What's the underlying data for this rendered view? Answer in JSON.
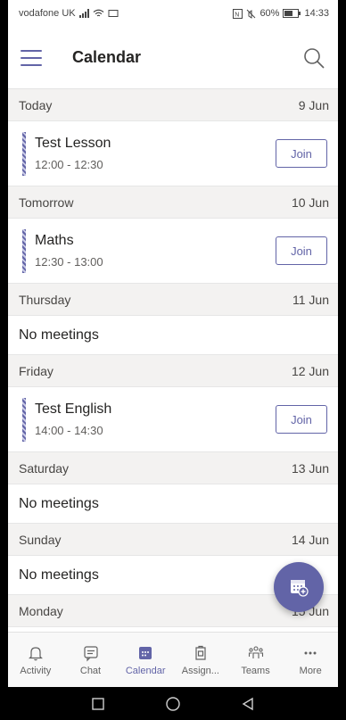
{
  "status_bar": {
    "carrier": "vodafone UK",
    "battery": "60%",
    "time": "14:33"
  },
  "header": {
    "title": "Calendar"
  },
  "agenda": [
    {
      "day": "Today",
      "date": "9 Jun",
      "meetings": [
        {
          "title": "Test Lesson",
          "time": "12:00 - 12:30",
          "join_label": "Join"
        }
      ]
    },
    {
      "day": "Tomorrow",
      "date": "10 Jun",
      "meetings": [
        {
          "title": "Maths",
          "time": "12:30 - 13:00",
          "join_label": "Join"
        }
      ]
    },
    {
      "day": "Thursday",
      "date": "11 Jun",
      "empty_text": "No meetings"
    },
    {
      "day": "Friday",
      "date": "12 Jun",
      "meetings": [
        {
          "title": "Test English",
          "time": "14:00 - 14:30",
          "join_label": "Join"
        }
      ]
    },
    {
      "day": "Saturday",
      "date": "13 Jun",
      "empty_text": "No meetings"
    },
    {
      "day": "Sunday",
      "date": "14 Jun",
      "empty_text": "No meetings"
    },
    {
      "day": "Monday",
      "date": "15 Jun"
    }
  ],
  "bottom_nav": [
    {
      "label": "Activity",
      "icon": "bell-icon"
    },
    {
      "label": "Chat",
      "icon": "chat-icon"
    },
    {
      "label": "Calendar",
      "icon": "calendar-icon",
      "active": true
    },
    {
      "label": "Assign...",
      "icon": "assignments-icon"
    },
    {
      "label": "Teams",
      "icon": "teams-icon"
    },
    {
      "label": "More",
      "icon": "more-icon"
    }
  ],
  "colors": {
    "accent": "#6264a7",
    "day_header_bg": "#f3f2f1"
  }
}
